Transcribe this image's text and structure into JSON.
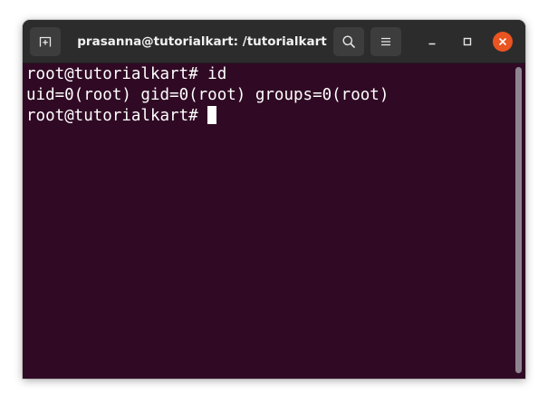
{
  "window": {
    "title": "prasanna@tutorialkart: /tutorialkart"
  },
  "icons": {
    "new_tab": "new-tab-icon",
    "search": "search-icon",
    "menu": "hamburger-menu-icon",
    "minimize": "minimize-icon",
    "maximize": "maximize-icon",
    "close": "close-icon"
  },
  "colors": {
    "terminal_background": "#300a24",
    "titlebar": "#2c2c2c",
    "close_button": "#e95420",
    "text": "#ffffff"
  },
  "terminal": {
    "lines": [
      "root@tutorialkart# id",
      "uid=0(root) gid=0(root) groups=0(root)",
      "root@tutorialkart# "
    ]
  }
}
